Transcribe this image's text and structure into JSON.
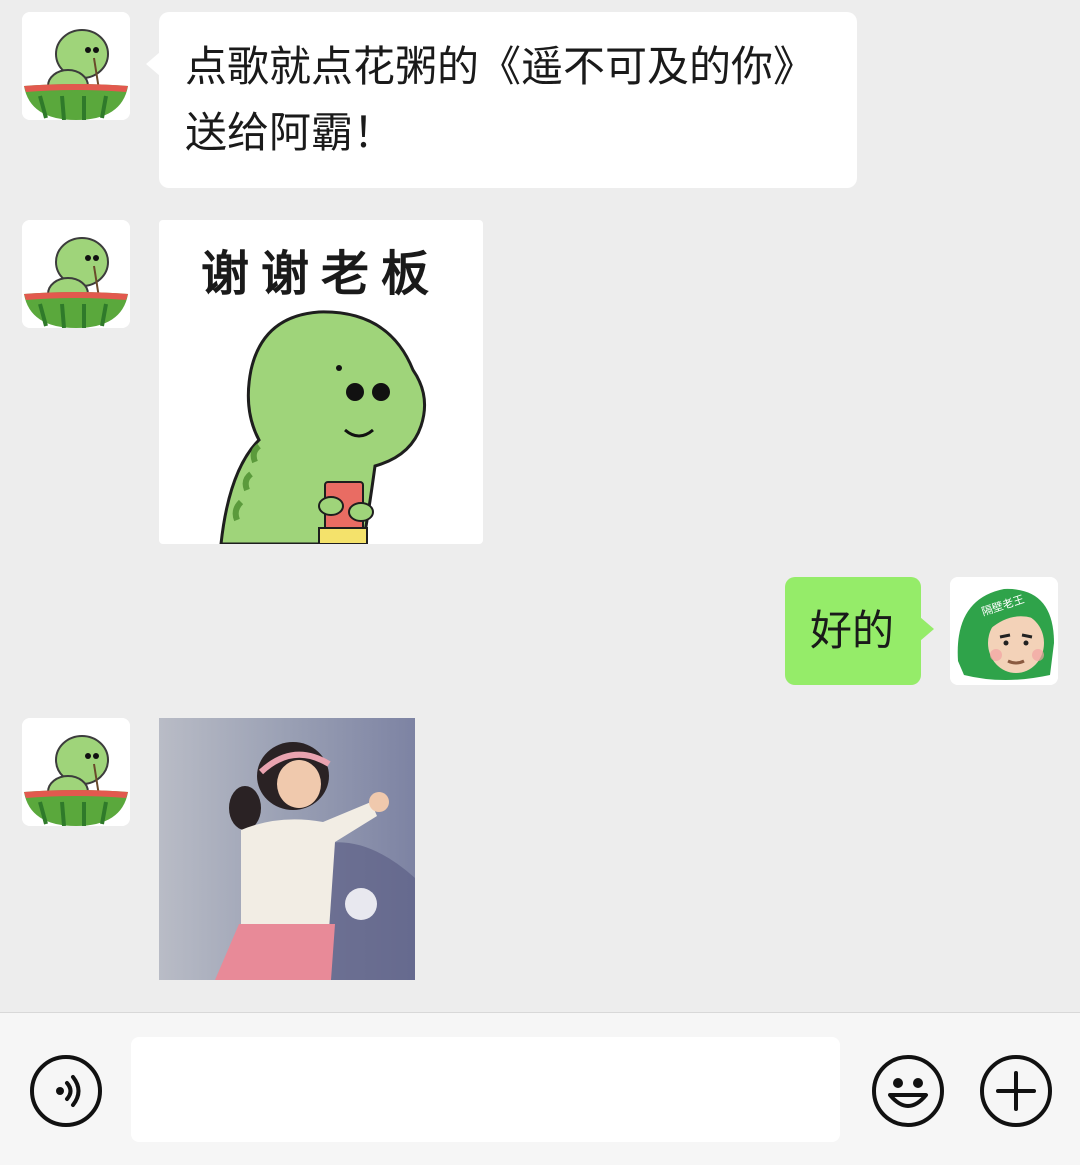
{
  "messages": [
    {
      "sender": "other",
      "type": "text",
      "lines": [
        "点歌就点花粥的《遥不可及的你》",
        "送给阿霸！"
      ]
    },
    {
      "sender": "other",
      "type": "sticker",
      "caption": "谢谢老板"
    },
    {
      "sender": "self",
      "type": "text",
      "text": "好的",
      "avatar_badge": "隔壁老王"
    },
    {
      "sender": "other",
      "type": "photo"
    }
  ],
  "input_bar": {
    "text_value": "",
    "icons": [
      "voice-icon",
      "emoji-icon",
      "plus-icon"
    ]
  },
  "colors": {
    "background": "#ededed",
    "other_bubble": "#ffffff",
    "self_bubble": "#95ec69",
    "dino_green": "#9fd47a"
  }
}
